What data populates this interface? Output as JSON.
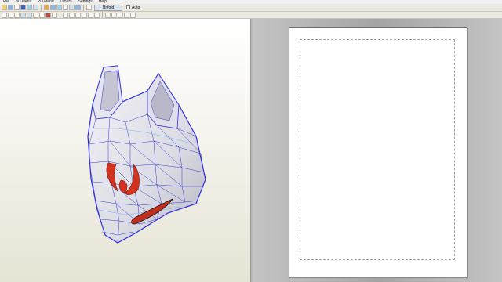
{
  "menu": {
    "items": [
      "File",
      "3D Menu",
      "2D Menu",
      "Others",
      "Settings",
      "Help"
    ]
  },
  "toolbar": {
    "unfold_label": "Unfold",
    "auto_label": "Auto"
  },
  "model": {
    "name_icon": "fox-mask-model",
    "mesh_color": "#3b3bd6",
    "accent_color": "#d1331f"
  },
  "paper": {
    "background": "#ffffff"
  }
}
